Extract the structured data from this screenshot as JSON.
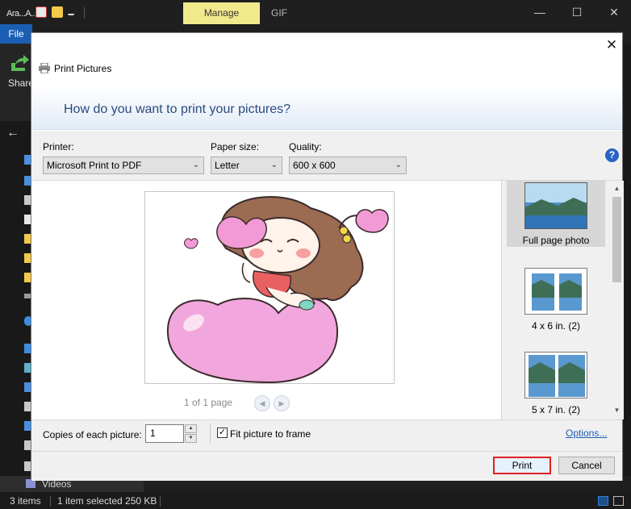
{
  "explorer": {
    "qa_text": "Ara...A...",
    "contextual_tab": "Manage",
    "second_tab": "GIF",
    "file_tab": "File",
    "share_label": "Share",
    "sidebar_videos": "Videos",
    "status": {
      "items_count": "3 items",
      "selection": "1 item selected  250 KB"
    }
  },
  "dialog": {
    "title": "Print Pictures",
    "heading": "How do you want to print your pictures?",
    "printer": {
      "label": "Printer:",
      "value": "Microsoft Print to PDF"
    },
    "paper_size": {
      "label": "Paper size:",
      "value": "Letter"
    },
    "quality": {
      "label": "Quality:",
      "value": "600 x 600"
    },
    "help_glyph": "?",
    "page_indicator": "1 of 1 page",
    "layouts": [
      {
        "label": "Full page photo",
        "selected": true
      },
      {
        "label": "4 x 6 in. (2)",
        "selected": false
      },
      {
        "label": "5 x 7 in. (2)",
        "selected": false
      }
    ],
    "copies_label": "Copies of each picture:",
    "copies_value": "1",
    "fit_label": "Fit picture to frame",
    "fit_checked": true,
    "options_link": "Options...",
    "print_button": "Print",
    "cancel_button": "Cancel"
  },
  "colors": {
    "accent_blue": "#1a5fb4",
    "manage_tab": "#f2e98d",
    "print_highlight": "#e02020"
  }
}
